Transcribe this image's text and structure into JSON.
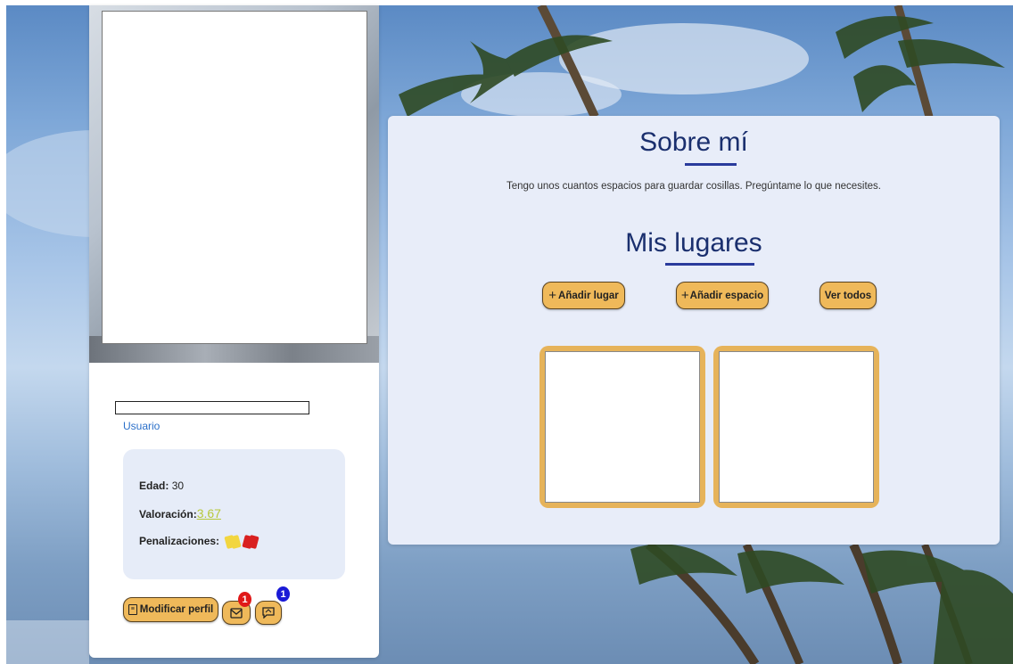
{
  "profile": {
    "role": "Usuario",
    "stats": {
      "age_label": "Edad:",
      "age_value": "30",
      "rating_label": "Valoración:",
      "rating_value": "3.67",
      "penalties_label": "Penalizaciones:"
    },
    "buttons": {
      "edit_profile": "Modificar perfil"
    },
    "badges": {
      "messages": "1",
      "chat": "1"
    }
  },
  "about": {
    "title": "Sobre mí",
    "text": "Tengo unos cuantos espacios para guardar cosillas. Pregúntame lo que necesites."
  },
  "places": {
    "title": "Mis lugares",
    "add_place": "Añadir lugar",
    "add_space": "Añadir espacio",
    "view_all": "Ver todos"
  },
  "colors": {
    "accent_button": "#efb95a",
    "heading": "#1a2f6e",
    "badge_red": "#e01818",
    "badge_blue": "#1a1ad6"
  },
  "icons": [
    "plus-icon",
    "envelope-icon",
    "chat-icon",
    "id-card-icon",
    "yellow-card-icon",
    "red-card-icon"
  ]
}
